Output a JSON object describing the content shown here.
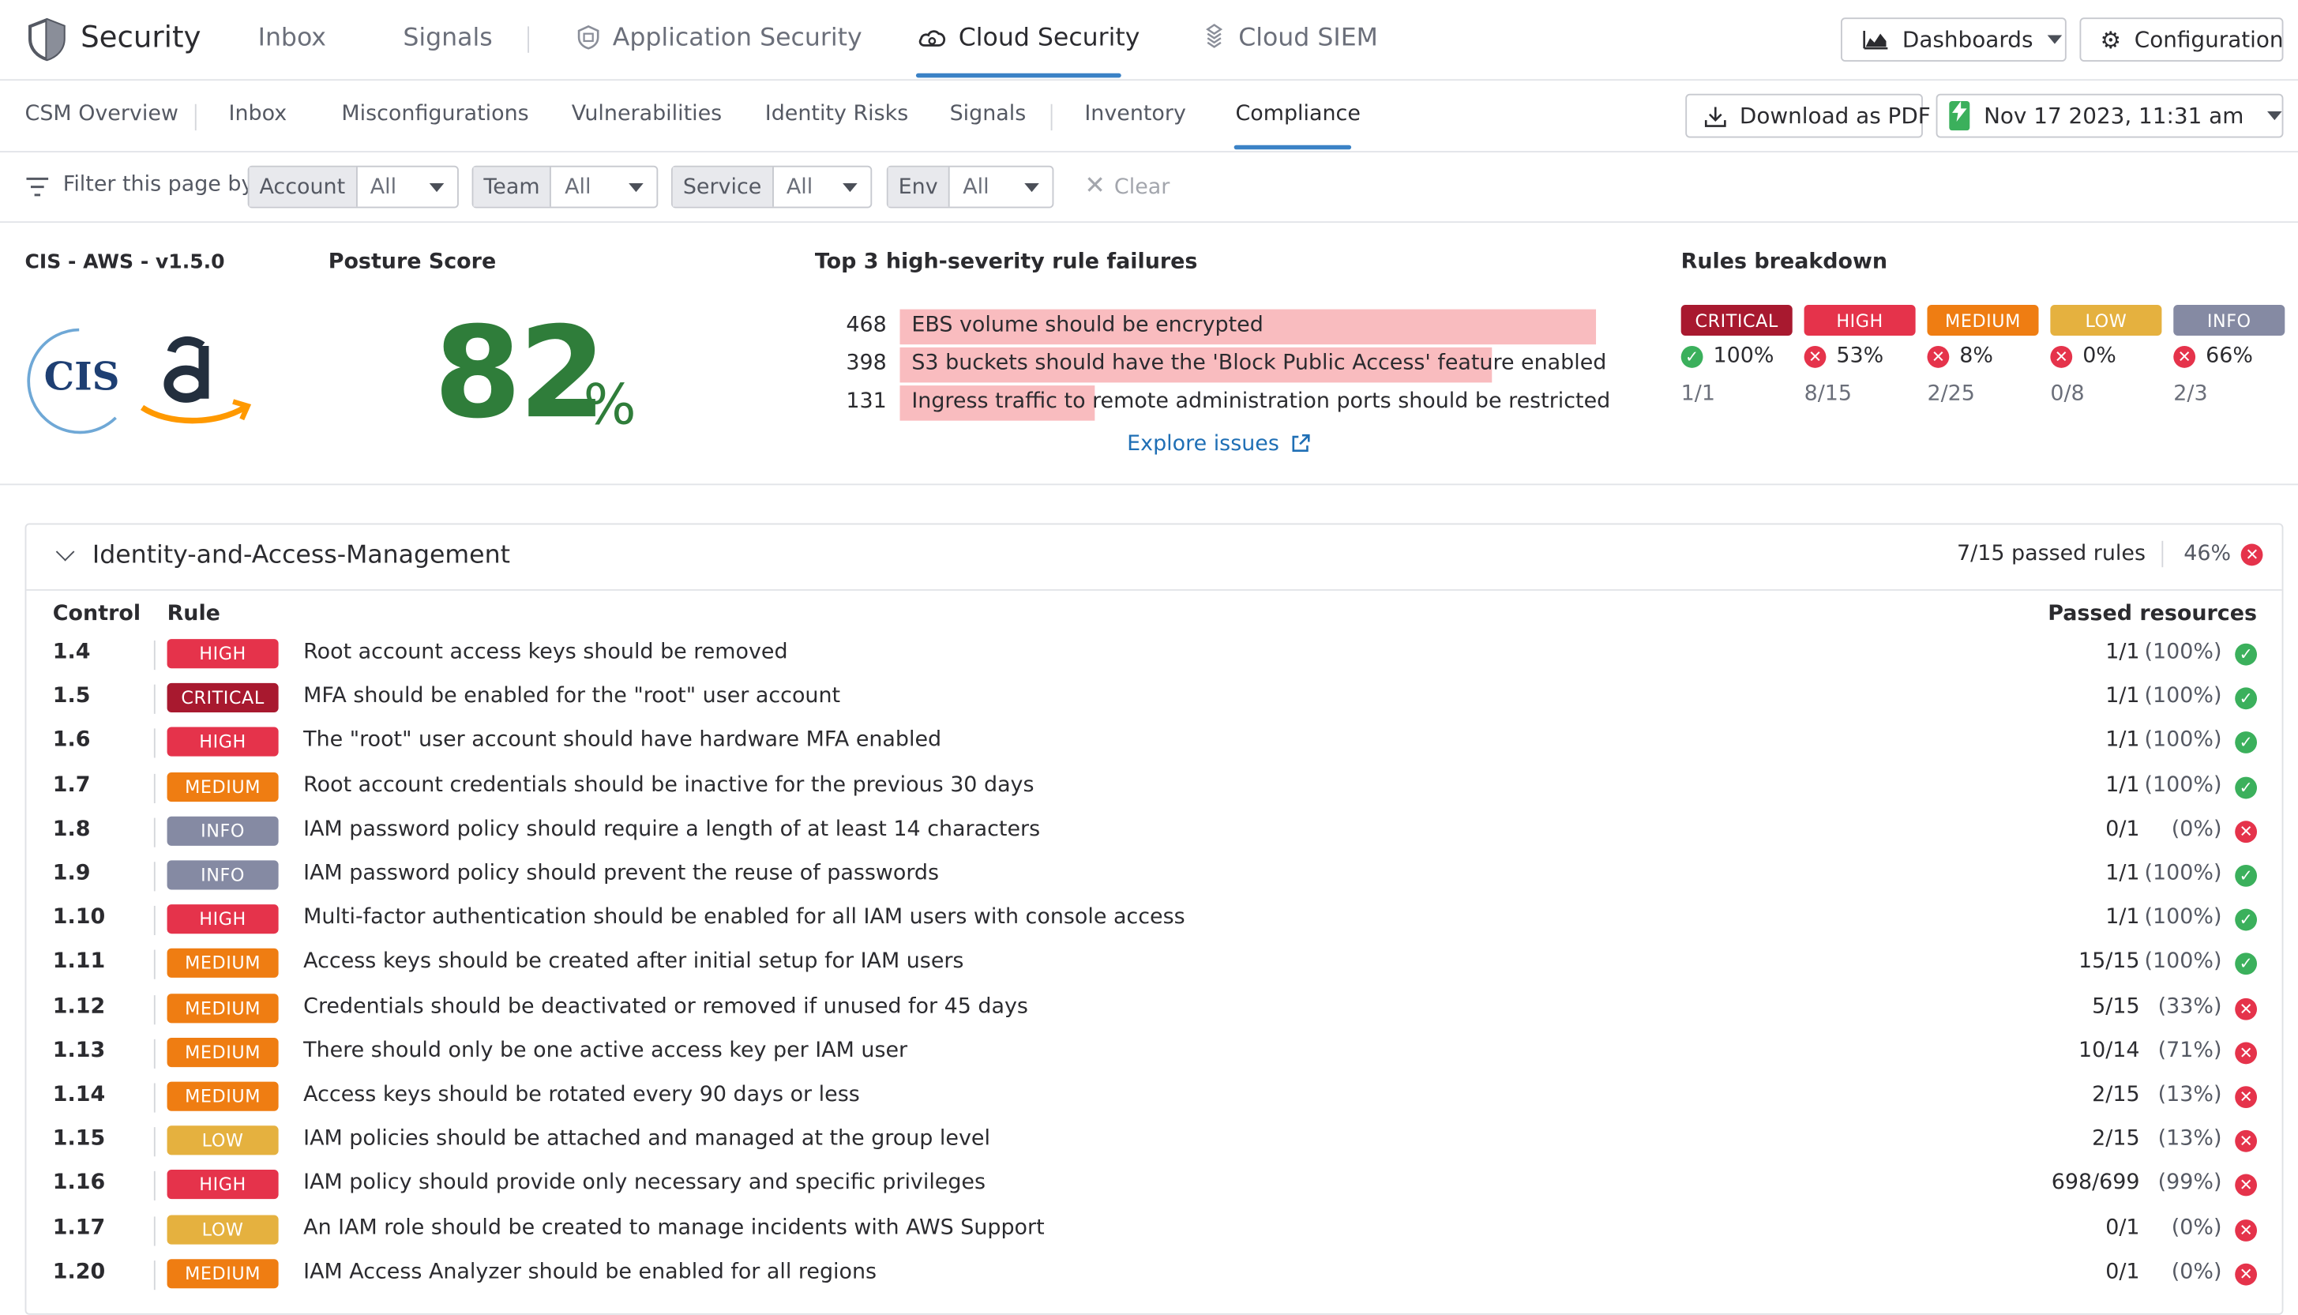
{
  "nav": {
    "brand": "Security",
    "items": [
      "Inbox",
      "Signals",
      "Application Security",
      "Cloud Security",
      "Cloud SIEM"
    ],
    "active": "Cloud Security",
    "dashboards": "Dashboards",
    "configuration": "Configuration"
  },
  "subnav": {
    "items": [
      "CSM Overview",
      "Inbox",
      "Misconfigurations",
      "Vulnerabilities",
      "Identity Risks",
      "Signals",
      "Inventory",
      "Compliance"
    ],
    "active": "Compliance",
    "download": "Download as PDF",
    "datetime": "Nov 17 2023, 11:31 am"
  },
  "filter": {
    "label": "Filter this page by",
    "chips": [
      {
        "key": "Account",
        "value": "All"
      },
      {
        "key": "Team",
        "value": "All"
      },
      {
        "key": "Service",
        "value": "All"
      },
      {
        "key": "Env",
        "value": "All"
      }
    ],
    "clear": "Clear"
  },
  "summary": {
    "framework": "CIS - AWS - v1.5.0",
    "cis_logo_text": "CIS",
    "posture_label": "Posture Score",
    "score": "82",
    "score_unit": "%",
    "failures_title": "Top 3 high-severity rule failures",
    "failures": [
      {
        "count": "468",
        "text": "EBS volume should be encrypted",
        "bar": 1.0
      },
      {
        "count": "398",
        "text": "S3 buckets should have the 'Block Public Access' feature enabled",
        "bar": 0.85
      },
      {
        "count": "131",
        "text": "Ingress traffic to remote administration ports should be restricted",
        "bar": 0.28
      }
    ],
    "explore": "Explore issues",
    "breakdown_title": "Rules breakdown",
    "breakdown": [
      {
        "label": "CRITICAL",
        "pct": "100%",
        "ok": true,
        "frac": "1/1",
        "color": "#a8192f"
      },
      {
        "label": "HIGH",
        "pct": "53%",
        "ok": false,
        "frac": "8/15",
        "color": "#e5334b"
      },
      {
        "label": "MEDIUM",
        "pct": "8%",
        "ok": false,
        "frac": "2/25",
        "color": "#ef7d12"
      },
      {
        "label": "LOW",
        "pct": "0%",
        "ok": false,
        "frac": "0/8",
        "color": "#e5b13f"
      },
      {
        "label": "INFO",
        "pct": "66%",
        "ok": false,
        "frac": "2/3",
        "color": "#858aa3"
      }
    ]
  },
  "section": {
    "title": "Identity-and-Access-Management",
    "passed_rules": "7/15 passed rules",
    "pct": "46%",
    "col_control": "Control",
    "col_rule": "Rule",
    "col_passed": "Passed resources",
    "rows": [
      {
        "control": "1.4",
        "sev": "HIGH",
        "rule": "Root account access keys should be removed",
        "frac": "1/1",
        "pct": "(100%)",
        "ok": true
      },
      {
        "control": "1.5",
        "sev": "CRITICAL",
        "rule": "MFA should be enabled for the \"root\" user account",
        "frac": "1/1",
        "pct": "(100%)",
        "ok": true
      },
      {
        "control": "1.6",
        "sev": "HIGH",
        "rule": "The \"root\" user account should have hardware MFA enabled",
        "frac": "1/1",
        "pct": "(100%)",
        "ok": true
      },
      {
        "control": "1.7",
        "sev": "MEDIUM",
        "rule": "Root account credentials should be inactive for the previous 30 days",
        "frac": "1/1",
        "pct": "(100%)",
        "ok": true
      },
      {
        "control": "1.8",
        "sev": "INFO",
        "rule": "IAM password policy should require a length of at least 14 characters",
        "frac": "0/1",
        "pct": "(0%)",
        "ok": false
      },
      {
        "control": "1.9",
        "sev": "INFO",
        "rule": "IAM password policy should prevent the reuse of passwords",
        "frac": "1/1",
        "pct": "(100%)",
        "ok": true
      },
      {
        "control": "1.10",
        "sev": "HIGH",
        "rule": "Multi-factor authentication should be enabled for all IAM users with console access",
        "frac": "1/1",
        "pct": "(100%)",
        "ok": true
      },
      {
        "control": "1.11",
        "sev": "MEDIUM",
        "rule": "Access keys should be created after initial setup for IAM users",
        "frac": "15/15",
        "pct": "(100%)",
        "ok": true
      },
      {
        "control": "1.12",
        "sev": "MEDIUM",
        "rule": "Credentials should be deactivated or removed if unused for 45 days",
        "frac": "5/15",
        "pct": "(33%)",
        "ok": false
      },
      {
        "control": "1.13",
        "sev": "MEDIUM",
        "rule": "There should only be one active access key per IAM user",
        "frac": "10/14",
        "pct": "(71%)",
        "ok": false
      },
      {
        "control": "1.14",
        "sev": "MEDIUM",
        "rule": "Access keys should be rotated every 90 days or less",
        "frac": "2/15",
        "pct": "(13%)",
        "ok": false
      },
      {
        "control": "1.15",
        "sev": "LOW",
        "rule": "IAM policies should be attached and managed at the group level",
        "frac": "2/15",
        "pct": "(13%)",
        "ok": false
      },
      {
        "control": "1.16",
        "sev": "HIGH",
        "rule": "IAM policy should provide only necessary and specific privileges",
        "frac": "698/699",
        "pct": "(99%)",
        "ok": false
      },
      {
        "control": "1.17",
        "sev": "LOW",
        "rule": "An IAM role should be created to manage incidents with AWS Support",
        "frac": "0/1",
        "pct": "(0%)",
        "ok": false
      },
      {
        "control": "1.20",
        "sev": "MEDIUM",
        "rule": "IAM Access Analyzer should be enabled for all regions",
        "frac": "0/1",
        "pct": "(0%)",
        "ok": false
      }
    ]
  },
  "colors": {
    "CRITICAL": "#a8192f",
    "HIGH": "#e5334b",
    "MEDIUM": "#ef7d12",
    "LOW": "#e5b13f",
    "INFO": "#858aa3",
    "accent": "#3b82c6",
    "score": "#2f7d3a"
  }
}
